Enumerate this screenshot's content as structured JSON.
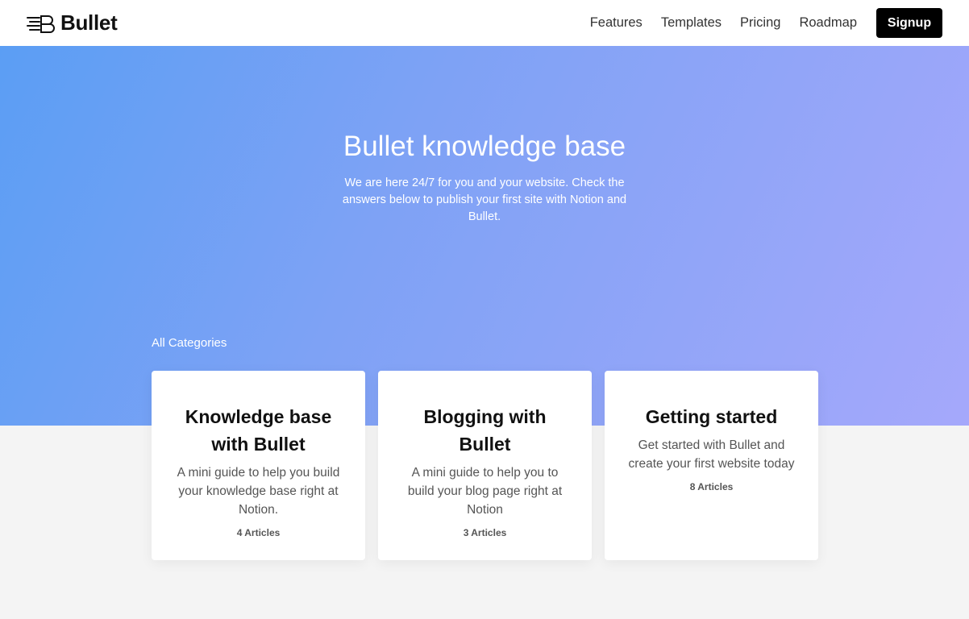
{
  "brand": {
    "name": "Bullet",
    "logo_icon": "bullet-logo-icon"
  },
  "nav": {
    "links": [
      "Features",
      "Templates",
      "Pricing",
      "Roadmap"
    ],
    "signup_label": "Signup"
  },
  "hero": {
    "title": "Bullet knowledge base",
    "subtitle": "We are here 24/7 for you and your website. Check the answers below to publish your first site with Notion and Bullet.",
    "gradient_colors": [
      "#5b9ef4",
      "#a5a8fb"
    ]
  },
  "categories": {
    "heading": "All Categories",
    "cards": [
      {
        "title": "Knowledge base with Bullet",
        "description": "A mini guide to help you build your knowledge base right at Notion.",
        "count": "4 Articles"
      },
      {
        "title": "Blogging with Bullet",
        "description": "A mini guide to help you to build your blog page right at Notion",
        "count": "3 Articles"
      },
      {
        "title": "Getting started",
        "description": "Get started with Bullet and create your first website today",
        "count": "8 Articles"
      }
    ]
  }
}
